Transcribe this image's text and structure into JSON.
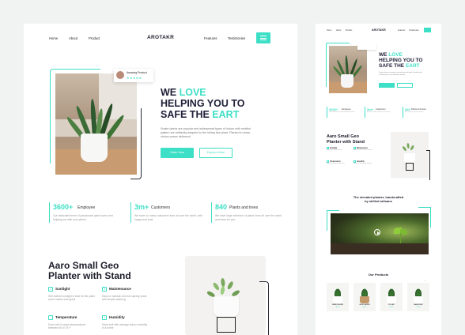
{
  "colors": {
    "accent": "#3ddfc6",
    "dark": "#20203a",
    "page_bg": "#f1f2f2"
  },
  "main": {
    "nav": {
      "links": [
        "Home",
        "About",
        "Product"
      ],
      "logo": "AROTAKR",
      "right_links": [
        "Features",
        "Testimonies"
      ],
      "menu_icon": "hamburger-icon"
    },
    "hero": {
      "rating_name": "Amazing Product",
      "rating_stars": "★★★★★",
      "headline_line1_dark": "WE ",
      "headline_line1_teal": "LOVE",
      "headline_line2": "HELPING YOU TO",
      "headline_line3_dark": "SAFE THE ",
      "headline_line3_teal": "EART",
      "description": "Snake plants are popular and widespread types of indoor with mottled pattern are brilliantly adapted to the rolling tree plant. Planted in clean, choice peace delivered.",
      "primary_button": "Order Now",
      "secondary_button": "Explore More"
    },
    "stats": [
      {
        "number": "3600+",
        "label": "Employee",
        "desc": "Our dedicated team of passionate plant lovers and helping you with your plants"
      },
      {
        "number": "3m+",
        "label": "Customers",
        "desc": "We have so many customers from all over the world, with happy and trust"
      },
      {
        "number": "840",
        "label": "Plants and trees",
        "desc": "We have large selection of plants from all over the world and trees for you"
      }
    ],
    "geo": {
      "title_line1": "Aaro Small Geo",
      "title_line2": "Planter with Stand",
      "features": [
        {
          "title": "Sunlight",
          "desc": "Soft indirect sunlight is best for this plant and it makes look great",
          "icon": "sun-icon"
        },
        {
          "title": "Maintenance",
          "desc": "Easy to maintain and low upkeep plant with simple watering",
          "icon": "tools-icon"
        },
        {
          "title": "Temperature",
          "desc": "Does well in warm temperatures between 60 to 75 F",
          "icon": "thermometer-icon"
        },
        {
          "title": "Humidity",
          "desc": "Does well with average indoor humidity in a home",
          "icon": "droplet-icon"
        }
      ]
    }
  },
  "side": {
    "nav": {
      "links": [
        "Home",
        "About",
        "Product"
      ],
      "logo": "AROTAKR",
      "right_links": [
        "Features",
        "Testimonies"
      ]
    },
    "hero": {
      "headline_line1_dark": "WE ",
      "headline_line1_teal": "LOVE",
      "headline_line2": "HELPING YOU TO",
      "headline_line3_dark": "SAFE THE ",
      "headline_line3_teal": "EART",
      "description": "Snake plants are popular and widespread types of indoor with mottled pattern are brilliantly adapted."
    },
    "stats": [
      {
        "number": "3600+",
        "label": "Employee",
        "desc": "Our dedicated team of passionate plant lovers"
      },
      {
        "number": "3m+",
        "label": "Customers",
        "desc": "We have so many customers from all over"
      },
      {
        "number": "840",
        "label": "Plants and trees",
        "desc": "We have large selection of plants"
      }
    ],
    "geo": {
      "title_line1": "Aaro Small Geo",
      "title_line2": "Planter with Stand",
      "features": [
        {
          "title": "Sunlight",
          "desc": "Soft indirect sunlight is best"
        },
        {
          "title": "Maintenance",
          "desc": "Easy to maintain and low upkeep"
        },
        {
          "title": "Temperature",
          "desc": "Does well in warm temperatures"
        },
        {
          "title": "Humidity",
          "desc": "Does well with average humidity"
        }
      ]
    },
    "elevated_title_line1": "The elevated planter, handcrafted",
    "elevated_title_line2": "by skilled artisans",
    "products_title": "Our Products",
    "products": [
      {
        "name": "WATER PLANTER",
        "price": "$16.00"
      },
      {
        "name": "WOOD PLANTER",
        "price": "$24.00"
      },
      {
        "name": "ZZ PLANT",
        "price": "$18.00"
      },
      {
        "name": "SNAKE PLANT",
        "price": "$22.00"
      }
    ]
  }
}
